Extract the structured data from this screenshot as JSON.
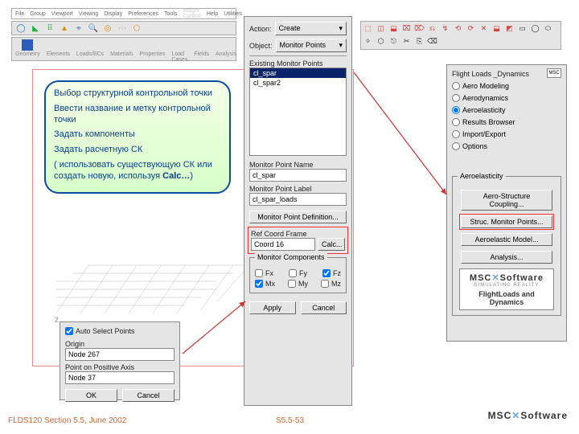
{
  "menubar": [
    "File",
    "Group",
    "Viewport",
    "Viewing",
    "Display",
    "Preferences",
    "Tools",
    "Insight Control",
    "Help",
    "Utilities"
  ],
  "toolbar1_icons": [
    "blue",
    "cube",
    "points",
    "tri",
    "mag",
    "zoom",
    "rings",
    "more",
    "pent"
  ],
  "toolbar2_items": [
    "Geometry",
    "Elements",
    "Loads/BCs",
    "Materials",
    "Properties",
    "Load Cases",
    "Fields",
    "Analysis"
  ],
  "center": {
    "action_label": "Action:",
    "action_value": "Create",
    "object_label": "Object:",
    "object_value": "Monitor Points",
    "existing_label": "Existing Monitor Points",
    "existing_items": [
      "cl_spar",
      "cl_spar2"
    ],
    "mp_name_label": "Monitor Point Name",
    "mp_name_value": "cl_spar",
    "mp_label_label": "Monitor Point Label",
    "mp_label_value": "cl_spar_loads",
    "mp_def_btn": "Monitor Point Definition...",
    "ref_frame_label": "Ref Coord Frame",
    "ref_frame_value": "Coord 16",
    "calc_btn": "Calc...",
    "components_label": "Monitor Components",
    "fx": "Fx",
    "fy": "Fy",
    "fz": "Fz",
    "mx": "Mx",
    "my": "My",
    "mz": "Mz",
    "apply": "Apply",
    "cancel": "Cancel"
  },
  "right": {
    "title": "Flight Loads _Dynamics",
    "radios": [
      "Aero Modeling",
      "Aerodynamics",
      "Aeroelasticity",
      "Results Browser",
      "Import/Export",
      "Options"
    ],
    "selected": 2,
    "group_label": "Aeroelasticity",
    "btns": [
      "Aero-Structure Coupling...",
      "Struc. Monitor Points...",
      "Aeroelastic Model...",
      "Analysis..."
    ],
    "highlight": 1,
    "logo_l1a": "MSC",
    "logo_l1b": "Software",
    "logo_l2": "SIMULATING REALITY",
    "logo_l3": "FlightLoads and Dynamics",
    "msc_small": "MSC"
  },
  "auto_panel": {
    "auto_sel": "Auto Select Points",
    "origin_label": "Origin",
    "origin_value": "Node 267",
    "axis_label": "Point on Positive Axis",
    "axis_value": "Node 37",
    "ok": "OK",
    "cancel": "Cancel"
  },
  "callout": {
    "l1": "Выбор структурной контрольной точки",
    "l2": "Ввести название и метку контрольной точки",
    "l3": "Задать компоненты",
    "l4": "Задать расчетную СК",
    "l5": "  ( использовать существующую СК или создать новую, используя ",
    "l5b": "Calc…",
    "l5c": ")"
  },
  "footer": {
    "left": "FLDS120 Section 5.5, June 2002",
    "center": "S5.5-53",
    "logo_a": "MSC",
    "logo_b": "Software"
  },
  "axis_z": "Z"
}
